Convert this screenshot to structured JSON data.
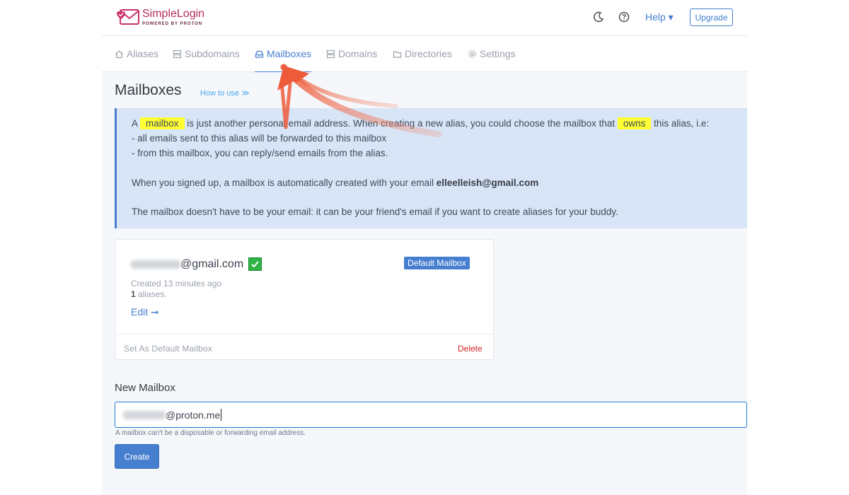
{
  "header": {
    "logo_title": "SimpleLogin",
    "logo_subtitle": "POWERED BY PROTON",
    "help_label": "Help ▾",
    "upgrade_label": "Upgrade"
  },
  "nav": {
    "items": [
      {
        "label": "Aliases",
        "icon": "home-icon"
      },
      {
        "label": "Subdomains",
        "icon": "server-icon"
      },
      {
        "label": "Mailboxes",
        "icon": "inbox-icon",
        "active": true
      },
      {
        "label": "Domains",
        "icon": "server-icon"
      },
      {
        "label": "Directories",
        "icon": "folder-icon"
      },
      {
        "label": "Settings",
        "icon": "gear-icon"
      }
    ]
  },
  "page": {
    "title": "Mailboxes",
    "how_to_use": "How to use ≫"
  },
  "info": {
    "line1_a": "A ",
    "line1_hl1": "mailbox",
    "line1_b": " is just another personal email address. When creating a new alias, you could choose the mailbox that ",
    "line1_hl2": "owns",
    "line1_c": " this alias, i.e:",
    "line2": "- all emails sent to this alias will be forwarded to this mailbox",
    "line3": "- from this mailbox, you can reply/send emails from the alias.",
    "line4_a": "When you signed up, a mailbox is automatically created with your email ",
    "line4_email": "elleelleish@gmail.com",
    "line5": "The mailbox doesn't have to be your email: it can be your friend's email if you want to create aliases for your buddy."
  },
  "mailbox_card": {
    "email_suffix": "@gmail.com",
    "badge": "Default Mailbox",
    "created": "Created 13 minutes ago",
    "alias_count": "1",
    "alias_suffix": " aliases.",
    "edit_label": "Edit ➞",
    "set_default_label": "Set As Default Mailbox",
    "delete_label": "Delete"
  },
  "new_mailbox": {
    "title": "New Mailbox",
    "input_value_suffix": "@proton.me",
    "help_text": "A mailbox can't be a disposable or forwarding email address.",
    "create_label": "Create"
  },
  "colors": {
    "accent": "#467fcf",
    "highlight": "#ffff33",
    "annotation_arrow": "#ee5b3b",
    "brand": "#b52c5e"
  }
}
